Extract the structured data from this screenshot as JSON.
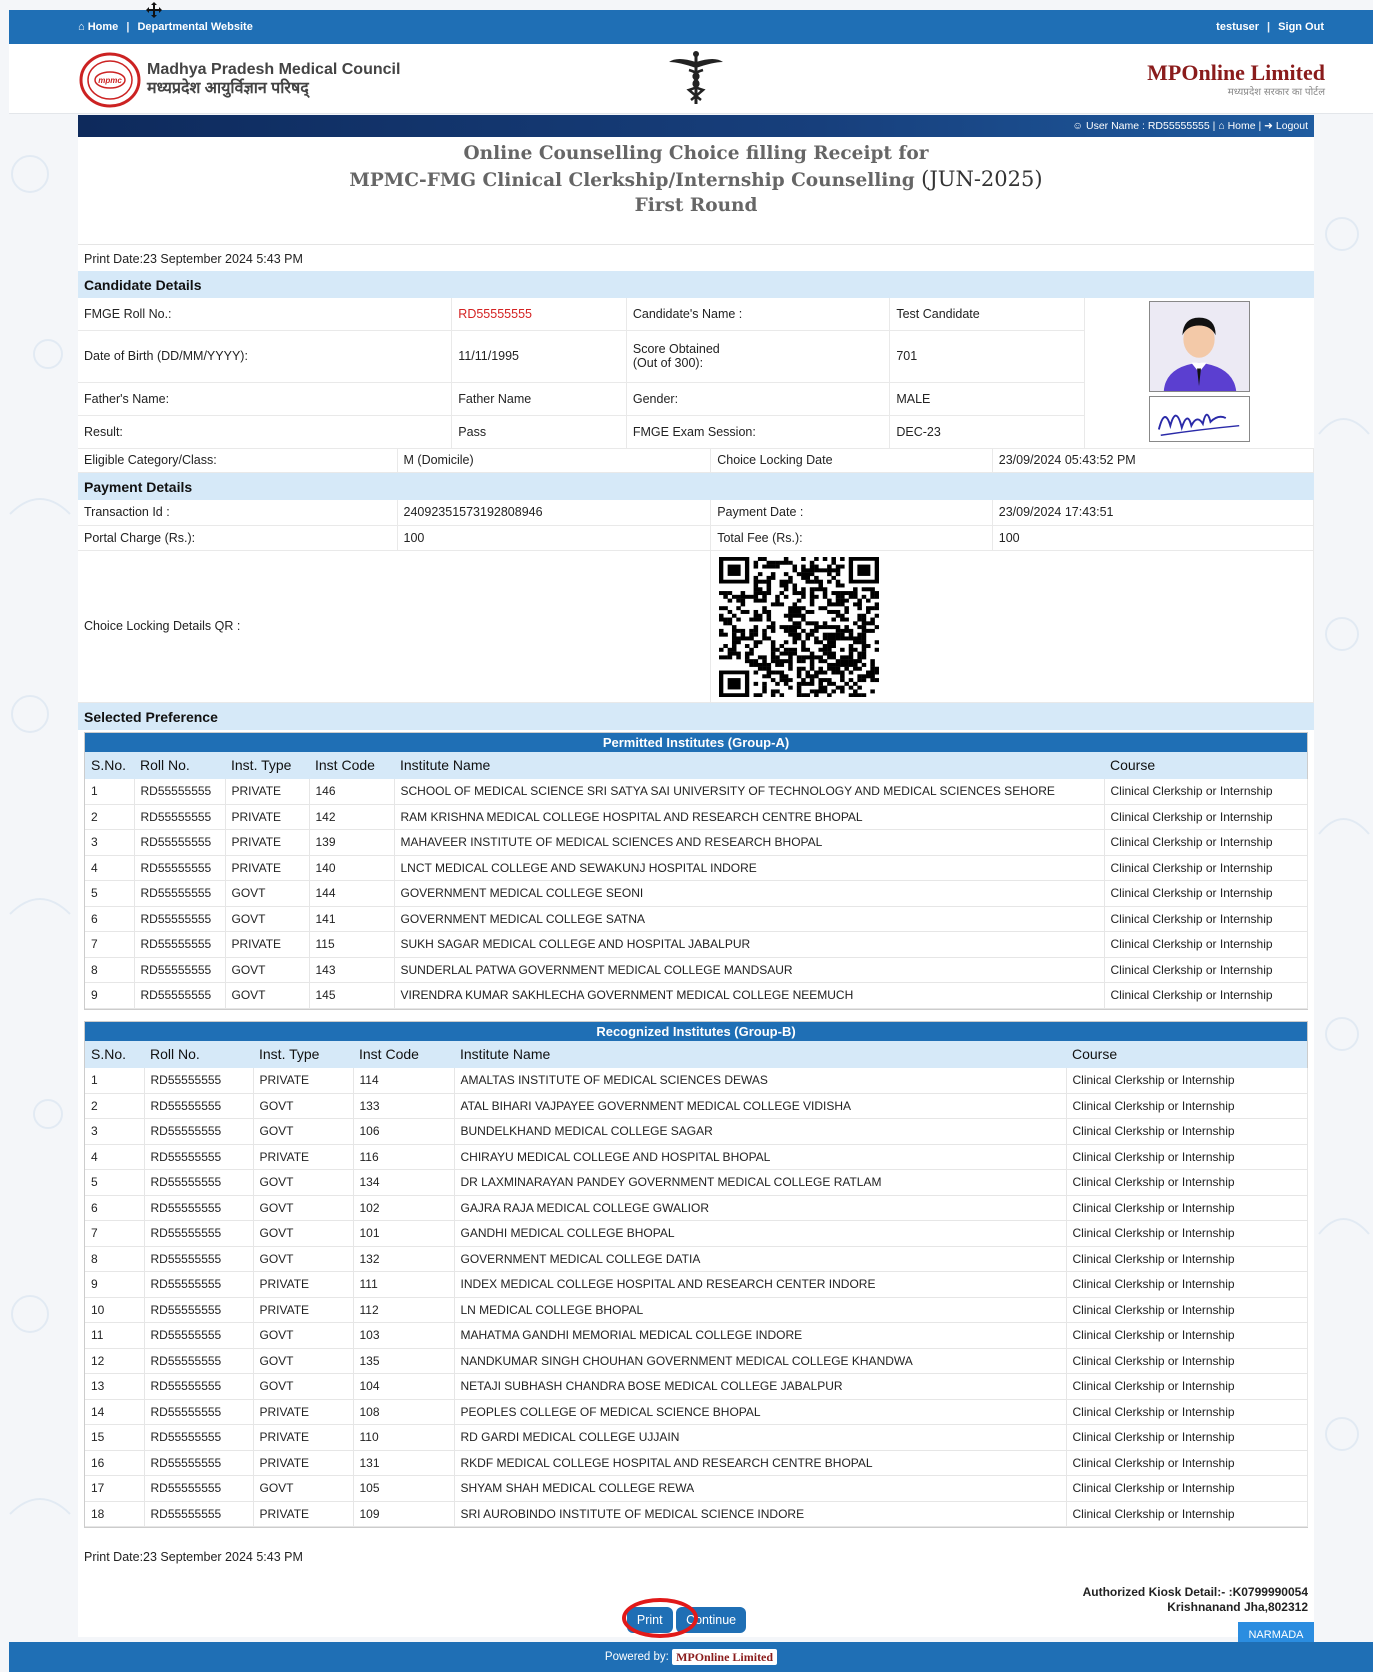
{
  "topbar": {
    "home": "Home",
    "departmental": "Departmental Website",
    "user": "testuser",
    "signout": "Sign Out"
  },
  "header": {
    "council_en": "Madhya Pradesh Medical Council",
    "council_hi": "मध्यप्रदेश आयुर्विज्ञान परिषद्",
    "mponline": "MPOnline Limited",
    "mponline_tag": "मध्यप्रदेश सरकार का पोर्टल"
  },
  "navstrip": {
    "username": "User Name : RD55555555 |",
    "home": "Home |",
    "logout": "Logout"
  },
  "title": {
    "line1": "Online Counselling Choice filling Receipt for",
    "line2": "MPMC-FMG Clinical Clerkship/Internship Counselling",
    "session": "(JUN-2025)",
    "line3": "First Round"
  },
  "print_date": "Print Date:23 September 2024 5:43 PM",
  "candidate": {
    "heading": "Candidate Details",
    "roll_label": "FMGE Roll No.:",
    "roll": "RD55555555",
    "name_label": "Candidate's Name :",
    "name": "Test Candidate",
    "dob_label": "Date of Birth (DD/MM/YYYY):",
    "dob": "11/11/1995",
    "score_label": "Score Obtained",
    "score_label2": "(Out of 300):",
    "score": "701",
    "father_label": "Father's Name:",
    "father": "Father Name",
    "gender_label": "Gender:",
    "gender": "MALE",
    "result_label": "Result:",
    "result": "Pass",
    "session_label": "FMGE Exam Session:",
    "session": "DEC-23",
    "category_label": "Eligible Category/Class:",
    "category": "M (Domicile)",
    "lockdate_label": "Choice Locking Date",
    "lockdate": "23/09/2024 05:43:52 PM"
  },
  "payment": {
    "heading": "Payment Details",
    "txn_label": "Transaction Id :",
    "txn": "24092351573192808946",
    "paydate_label": "Payment Date :",
    "paydate": "23/09/2024 17:43:51",
    "portal_label": "Portal Charge (Rs.):",
    "portal": "100",
    "total_label": "Total Fee (Rs.):",
    "total": "100",
    "qr_label": "Choice Locking Details QR :"
  },
  "preference": {
    "heading": "Selected Preference",
    "columns": [
      "S.No.",
      "Roll No.",
      "Inst. Type",
      "Inst Code",
      "Institute Name",
      "Course"
    ],
    "groupA_title": "Permitted Institutes (Group-A)",
    "groupA": [
      [
        "1",
        "RD55555555",
        "PRIVATE",
        "146",
        "SCHOOL OF MEDICAL SCIENCE SRI SATYA SAI UNIVERSITY OF TECHNOLOGY AND MEDICAL SCIENCES SEHORE",
        "Clinical Clerkship or Internship"
      ],
      [
        "2",
        "RD55555555",
        "PRIVATE",
        "142",
        "RAM KRISHNA MEDICAL COLLEGE HOSPITAL AND RESEARCH CENTRE BHOPAL",
        "Clinical Clerkship or Internship"
      ],
      [
        "3",
        "RD55555555",
        "PRIVATE",
        "139",
        "MAHAVEER INSTITUTE OF MEDICAL SCIENCES AND RESEARCH BHOPAL",
        "Clinical Clerkship or Internship"
      ],
      [
        "4",
        "RD55555555",
        "PRIVATE",
        "140",
        "LNCT MEDICAL COLLEGE AND SEWAKUNJ HOSPITAL INDORE",
        "Clinical Clerkship or Internship"
      ],
      [
        "5",
        "RD55555555",
        "GOVT",
        "144",
        "GOVERNMENT MEDICAL COLLEGE SEONI",
        "Clinical Clerkship or Internship"
      ],
      [
        "6",
        "RD55555555",
        "GOVT",
        "141",
        "GOVERNMENT MEDICAL COLLEGE SATNA",
        "Clinical Clerkship or Internship"
      ],
      [
        "7",
        "RD55555555",
        "PRIVATE",
        "115",
        "SUKH SAGAR MEDICAL COLLEGE AND HOSPITAL JABALPUR",
        "Clinical Clerkship or Internship"
      ],
      [
        "8",
        "RD55555555",
        "GOVT",
        "143",
        "SUNDERLAL PATWA GOVERNMENT MEDICAL COLLEGE MANDSAUR",
        "Clinical Clerkship or Internship"
      ],
      [
        "9",
        "RD55555555",
        "GOVT",
        "145",
        "VIRENDRA KUMAR SAKHLECHA GOVERNMENT MEDICAL COLLEGE NEEMUCH",
        "Clinical Clerkship or Internship"
      ]
    ],
    "groupB_title": "Recognized Institutes (Group-B)",
    "groupB": [
      [
        "1",
        "RD55555555",
        "PRIVATE",
        "114",
        "AMALTAS INSTITUTE OF MEDICAL SCIENCES DEWAS",
        "Clinical Clerkship or Internship"
      ],
      [
        "2",
        "RD55555555",
        "GOVT",
        "133",
        "ATAL BIHARI VAJPAYEE GOVERNMENT MEDICAL COLLEGE VIDISHA",
        "Clinical Clerkship or Internship"
      ],
      [
        "3",
        "RD55555555",
        "GOVT",
        "106",
        "BUNDELKHAND MEDICAL COLLEGE SAGAR",
        "Clinical Clerkship or Internship"
      ],
      [
        "4",
        "RD55555555",
        "PRIVATE",
        "116",
        "CHIRAYU MEDICAL COLLEGE AND HOSPITAL BHOPAL",
        "Clinical Clerkship or Internship"
      ],
      [
        "5",
        "RD55555555",
        "GOVT",
        "134",
        "DR LAXMINARAYAN PANDEY GOVERNMENT MEDICAL COLLEGE RATLAM",
        "Clinical Clerkship or Internship"
      ],
      [
        "6",
        "RD55555555",
        "GOVT",
        "102",
        "GAJRA RAJA MEDICAL COLLEGE GWALIOR",
        "Clinical Clerkship or Internship"
      ],
      [
        "7",
        "RD55555555",
        "GOVT",
        "101",
        "GANDHI MEDICAL COLLEGE BHOPAL",
        "Clinical Clerkship or Internship"
      ],
      [
        "8",
        "RD55555555",
        "GOVT",
        "132",
        "GOVERNMENT MEDICAL COLLEGE DATIA",
        "Clinical Clerkship or Internship"
      ],
      [
        "9",
        "RD55555555",
        "PRIVATE",
        "111",
        "INDEX MEDICAL COLLEGE HOSPITAL AND RESEARCH CENTER INDORE",
        "Clinical Clerkship or Internship"
      ],
      [
        "10",
        "RD55555555",
        "PRIVATE",
        "112",
        "LN MEDICAL COLLEGE BHOPAL",
        "Clinical Clerkship or Internship"
      ],
      [
        "11",
        "RD55555555",
        "GOVT",
        "103",
        "MAHATMA GANDHI MEMORIAL MEDICAL COLLEGE INDORE",
        "Clinical Clerkship or Internship"
      ],
      [
        "12",
        "RD55555555",
        "GOVT",
        "135",
        "NANDKUMAR SINGH CHOUHAN GOVERNMENT MEDICAL COLLEGE KHANDWA",
        "Clinical Clerkship or Internship"
      ],
      [
        "13",
        "RD55555555",
        "GOVT",
        "104",
        "NETAJI SUBHASH CHANDRA BOSE MEDICAL COLLEGE JABALPUR",
        "Clinical Clerkship or Internship"
      ],
      [
        "14",
        "RD55555555",
        "PRIVATE",
        "108",
        "PEOPLES COLLEGE OF MEDICAL SCIENCE BHOPAL",
        "Clinical Clerkship or Internship"
      ],
      [
        "15",
        "RD55555555",
        "PRIVATE",
        "110",
        "RD GARDI MEDICAL COLLEGE UJJAIN",
        "Clinical Clerkship or Internship"
      ],
      [
        "16",
        "RD55555555",
        "PRIVATE",
        "131",
        "RKDF MEDICAL COLLEGE HOSPITAL AND RESEARCH CENTRE BHOPAL",
        "Clinical Clerkship or Internship"
      ],
      [
        "17",
        "RD55555555",
        "GOVT",
        "105",
        "SHYAM SHAH MEDICAL COLLEGE REWA",
        "Clinical Clerkship or Internship"
      ],
      [
        "18",
        "RD55555555",
        "PRIVATE",
        "109",
        "SRI AUROBINDO INSTITUTE OF MEDICAL SCIENCE INDORE",
        "Clinical Clerkship or Internship"
      ]
    ]
  },
  "kiosk": {
    "line1": "Authorized Kiosk Detail:- :K0799990054",
    "line2": "Krishnanand Jha,802312"
  },
  "buttons": {
    "print": "Print",
    "continue": "Continue"
  },
  "footer": {
    "powered": "Powered by:",
    "brand": "MPOnline Limited",
    "narmada": "NARMADA"
  },
  "colors": {
    "primary": "#1f6fb5",
    "light_section": "#d6e9f8",
    "roll_red": "#d42222",
    "ring_red": "#e11919"
  }
}
